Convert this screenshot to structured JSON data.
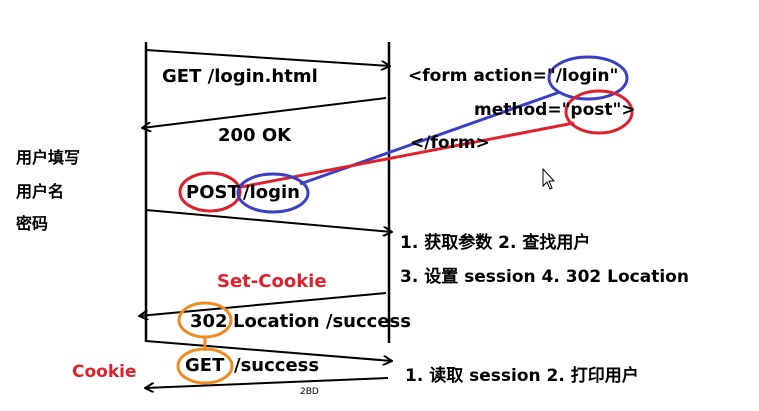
{
  "diagram": {
    "messages": {
      "get_login": "GET /login.html",
      "ok_200": "200 OK",
      "post_method": "POST",
      "post_path": "/login",
      "code_302": "302",
      "location": "Location /success",
      "get_method": "GET",
      "get_path": "/success"
    },
    "form_snippet": {
      "line1": "<form action=\"/login\"",
      "line2": "method=\"post\">",
      "line3": "</form>"
    },
    "client_notes": [
      "用户填写",
      "用户名",
      "密码"
    ],
    "server_notes": {
      "step1": "1. 获取参数 2. 查找用户",
      "step2": "3. 设置 session 4. 302 Location",
      "step3": "1. 读取 session 2. 打印用户"
    },
    "headers": {
      "set_cookie": "Set-Cookie",
      "cookie": "Cookie"
    },
    "scribble": "2BD"
  },
  "colors": {
    "ink": "#000000",
    "red": "#e0202a",
    "blue": "#3a3fc4",
    "orange": "#f28a22"
  }
}
